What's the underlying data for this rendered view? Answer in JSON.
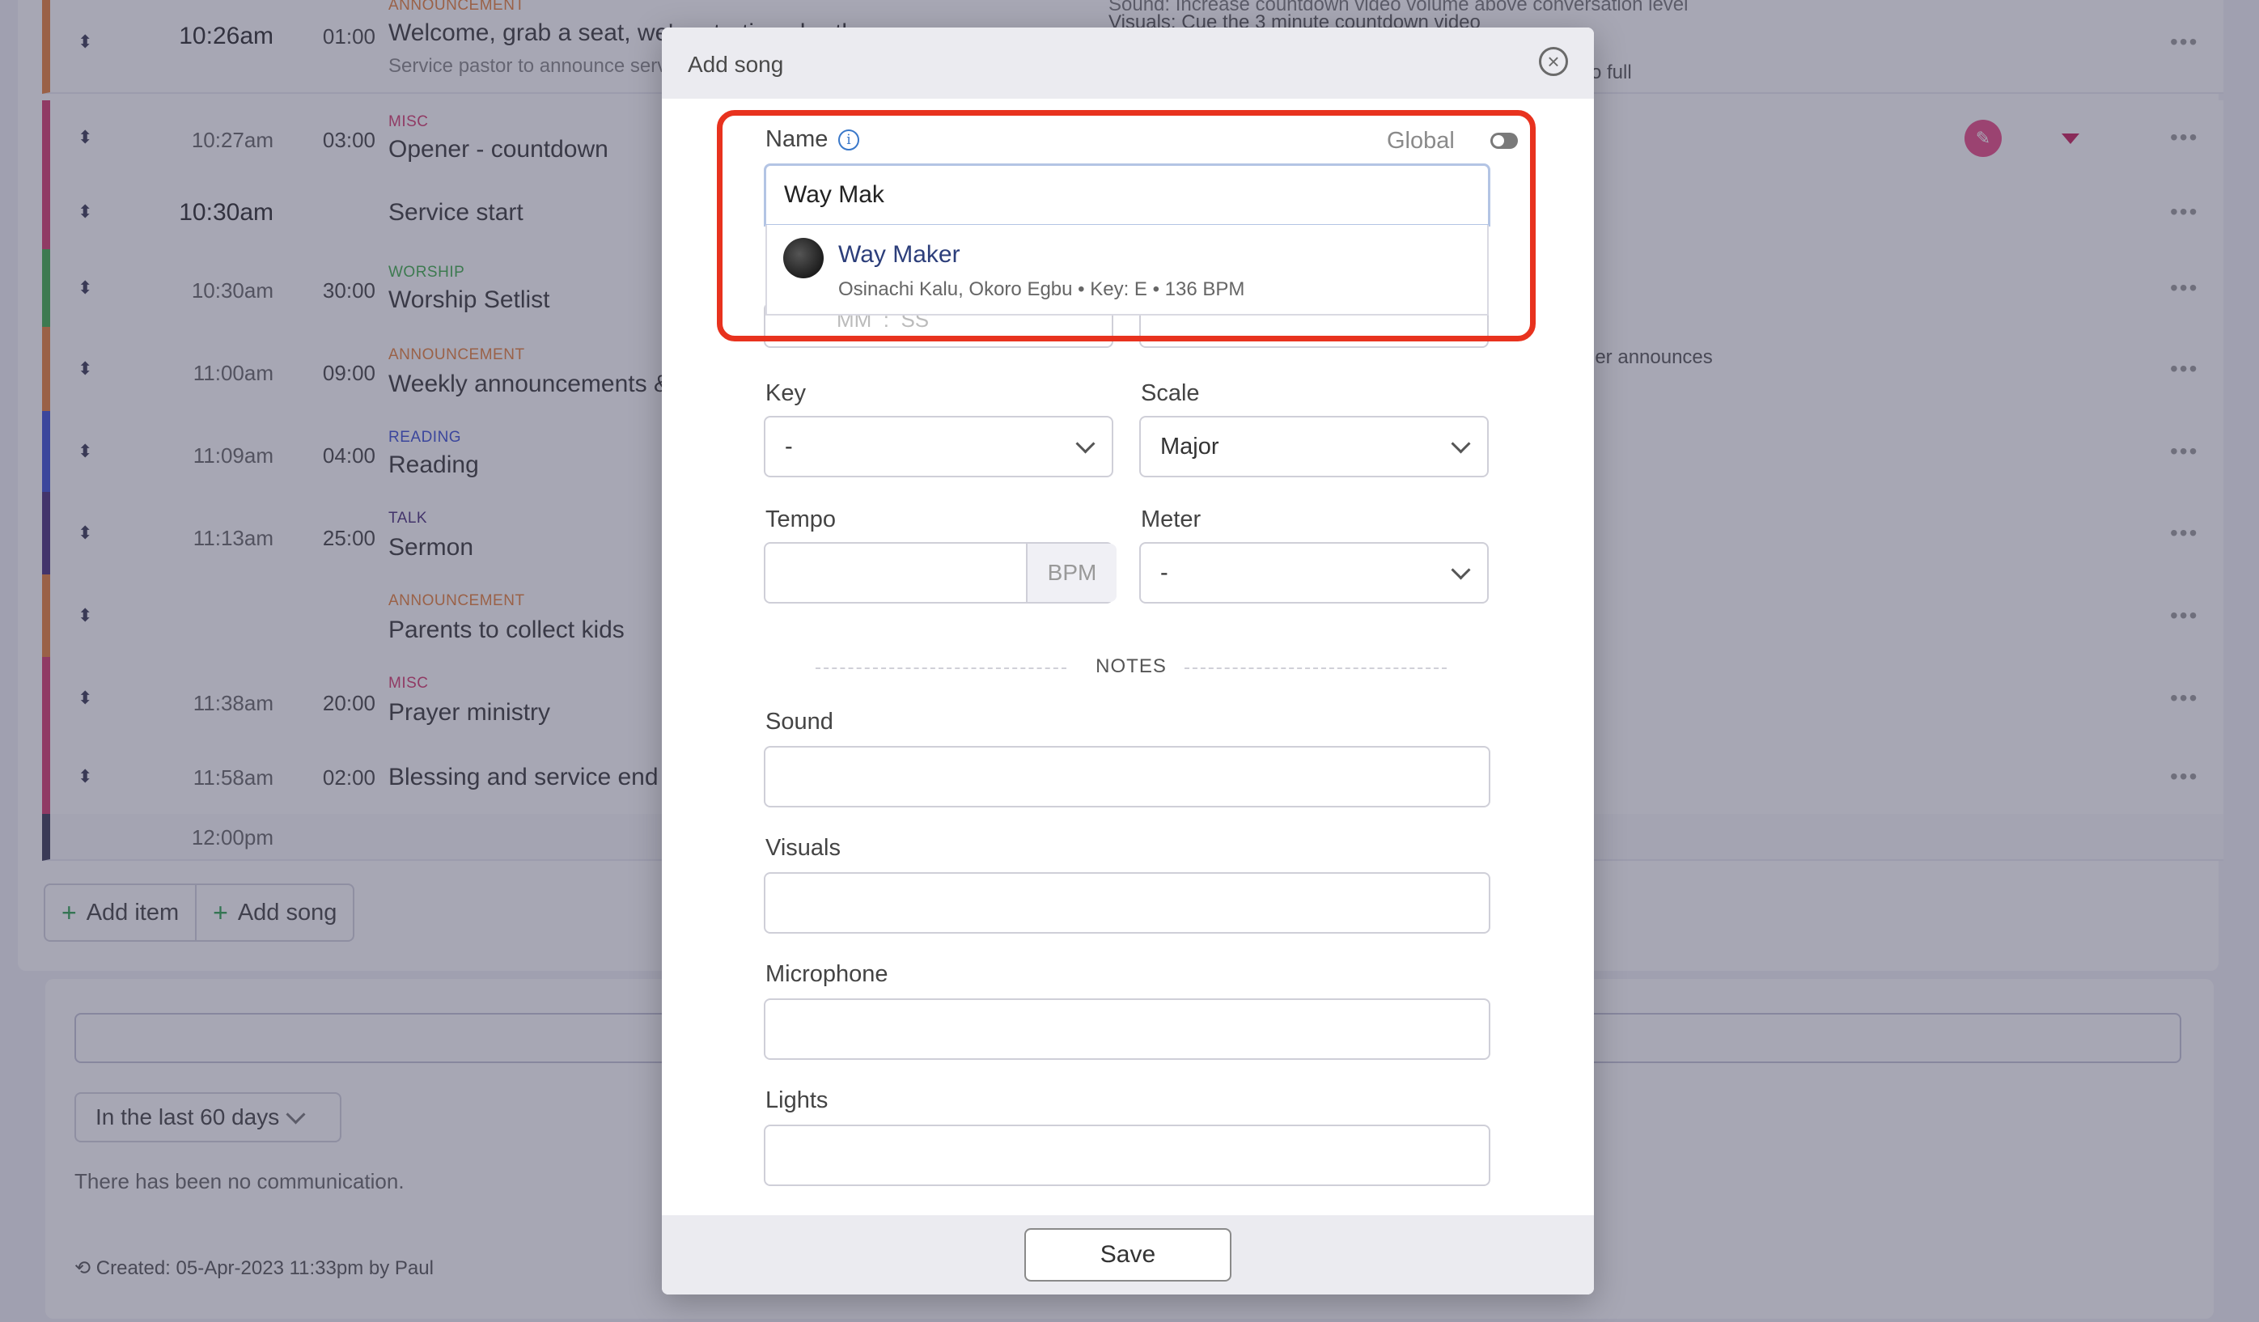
{
  "background": {
    "rows": [
      {
        "time": "10:26am",
        "time_bold": true,
        "duration": "01:00",
        "category": "ANNOUNCEMENT",
        "category_color": "#e8803a",
        "title": "Welcome, grab a seat, we're starting shortly",
        "subtitle": "Service pastor to announce service",
        "border_color": "#e8803a"
      },
      {
        "time": "10:27am",
        "duration": "03:00",
        "category": "MISC",
        "category_color": "#d63a6e",
        "title": "Opener - countdown",
        "border_color": "#d63a6e"
      },
      {
        "time": "10:30am",
        "time_bold": true,
        "duration": "",
        "category": "",
        "title": "Service start",
        "border_color": "#d63a6e"
      },
      {
        "time": "10:30am",
        "duration": "30:00",
        "category": "WORSHIP",
        "category_color": "#3fae4a",
        "title": "Worship Setlist",
        "border_color": "#3fae4a"
      },
      {
        "time": "11:00am",
        "duration": "09:00",
        "category": "ANNOUNCEMENT",
        "category_color": "#e8803a",
        "title": "Weekly announcements & offering",
        "border_color": "#e8803a"
      },
      {
        "time": "11:09am",
        "duration": "04:00",
        "category": "READING",
        "category_color": "#3b4fd4",
        "title": "Reading",
        "border_color": "#3b4fd4"
      },
      {
        "time": "11:13am",
        "duration": "25:00",
        "category": "TALK",
        "category_color": "#4a2f7a",
        "title": "Sermon",
        "border_color": "#4a2f7a"
      },
      {
        "time": "",
        "duration": "",
        "category": "ANNOUNCEMENT",
        "category_color": "#e8803a",
        "title": "Parents to collect kids",
        "border_color": "#e8803a"
      },
      {
        "time": "11:38am",
        "duration": "20:00",
        "category": "MISC",
        "category_color": "#d63a6e",
        "title": "Prayer ministry",
        "border_color": "#d63a6e"
      },
      {
        "time": "11:58am",
        "duration": "02:00",
        "category": "",
        "title": "Blessing and service end",
        "border_color": "#d63a6e"
      },
      {
        "time": "12:00pm",
        "duration": "",
        "category": "",
        "title": "",
        "border_color": "#3a3a55"
      }
    ],
    "notes_right": {
      "sound": "Sound:",
      "sound_text": "Increase countdown video volume above conversation level",
      "visuals": "Visuals:",
      "visuals_text": "Cue the 3 minute countdown video",
      "full": "o full",
      "announces": "ler announces"
    },
    "add_item_label": "Add item",
    "add_song_label": "Add song",
    "period_select": "In the last 60 days",
    "no_communication": "There has been no communication.",
    "created_text": "Created: 05-Apr-2023 11:33pm by Paul"
  },
  "modal": {
    "title": "Add song",
    "name_label": "Name",
    "global_label": "Global",
    "name_value": "Way Mak",
    "suggestion": {
      "name": "Way Maker",
      "meta": "Osinachi Kalu, Okoro Egbu • Key: E • 136 BPM"
    },
    "duration_placeholder_mm": "MM",
    "duration_placeholder_ss": "SS",
    "key_label": "Key",
    "key_value": "-",
    "scale_label": "Scale",
    "scale_value": "Major",
    "tempo_label": "Tempo",
    "tempo_unit": "BPM",
    "meter_label": "Meter",
    "meter_value": "-",
    "notes_heading": "NOTES",
    "sound_label": "Sound",
    "visuals_label": "Visuals",
    "microphone_label": "Microphone",
    "lights_label": "Lights",
    "save_label": "Save"
  },
  "colors": {
    "highlight": "#e8321e",
    "link": "#2c3e7a",
    "info": "#3a78c9"
  }
}
